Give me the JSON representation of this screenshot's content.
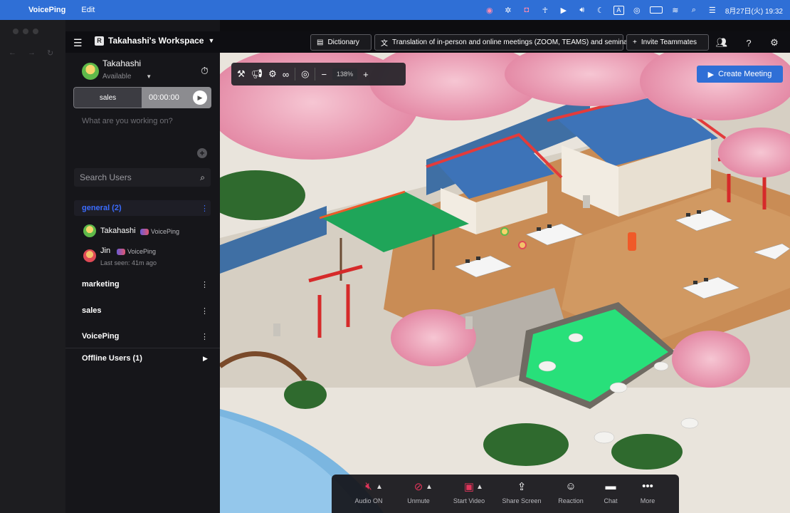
{
  "menubar": {
    "app_name": "VoicePing",
    "menu_edit": "Edit",
    "datetime": "8月27日(火) 19:32",
    "input_indicator": "A"
  },
  "workspace": {
    "name": "Takahashi's Workspace",
    "badge": "R"
  },
  "topbar": {
    "dictionary": "Dictionary",
    "translation": "Translation of in-person and online meetings (ZOOM, TEAMS) and seminars",
    "invite": "Invite Teammates"
  },
  "user": {
    "name": "Takahashi",
    "status": "Available"
  },
  "timer": {
    "task": "sales",
    "time": "00:00:00"
  },
  "status_placeholder": "What are you working on?",
  "search": {
    "placeholder": "Search Users"
  },
  "channels": {
    "general": "general (2)",
    "marketing": "marketing",
    "sales": "sales",
    "voiceping": "VoicePing",
    "offline": "Offline Users (1)"
  },
  "members": [
    {
      "name": "Takahashi",
      "tag": "VoicePing"
    },
    {
      "name": "Jin",
      "tag": "VoicePing",
      "last_seen": "Last seen: 41m ago"
    }
  ],
  "toolbar": {
    "zoom": "138%"
  },
  "create_meeting": "Create Meeting",
  "controls": {
    "audio": "Audio ON",
    "unmute": "Unmute",
    "video": "Start Video",
    "share": "Share Screen",
    "reaction": "Reaction",
    "chat": "Chat",
    "more": "More"
  },
  "colors": {
    "accent": "#2f6fd6",
    "mute_red": "#e0355a",
    "channel_active": "#3b6cff"
  }
}
